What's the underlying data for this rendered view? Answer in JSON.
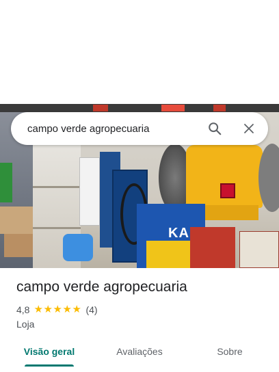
{
  "search": {
    "query": "campo verde agropecuaria",
    "search_icon": "search-icon",
    "clear_icon": "close-icon"
  },
  "place": {
    "name": "campo verde agropecuaria",
    "rating": "4,8",
    "stars": 5,
    "review_count": "(4)",
    "category": "Loja",
    "photo_text": "KALA"
  },
  "tabs": [
    {
      "label": "Visão geral",
      "active": true
    },
    {
      "label": "Avaliações",
      "active": false
    },
    {
      "label": "Sobre",
      "active": false
    }
  ],
  "colors": {
    "accent": "#00786f",
    "star": "#fbbc04"
  }
}
